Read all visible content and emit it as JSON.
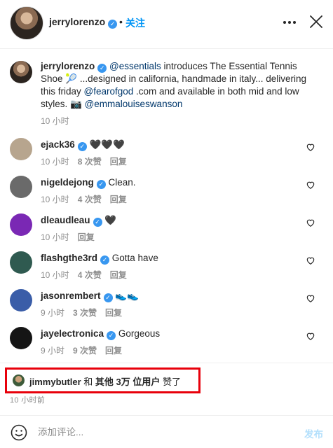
{
  "header": {
    "username": "jerrylorenzo",
    "separator": "•",
    "follow_label": "关注",
    "more_icon": "more-horizontal-icon",
    "close_icon": "close-icon"
  },
  "caption": {
    "username": "jerrylorenzo",
    "mention_1": "@essentials",
    "text_1": " introduces The Essential Tennis Shoe 🎾 ...designed in california, handmade in italy... delivering this friday ",
    "mention_2": "@fearofgod",
    "text_2": " .com and available in both mid and low styles. 📷 ",
    "mention_3": "@emmalouiseswanson",
    "time": "10 小时"
  },
  "comments": [
    {
      "username": "ejack36",
      "text": "🖤🖤🖤",
      "time": "10 小时",
      "likes": "8 次赞",
      "reply": "回复",
      "avatar_color": "#b7a58e"
    },
    {
      "username": "nigeldejong",
      "text": "Clean.",
      "time": "10 小时",
      "likes": "4 次赞",
      "reply": "回复",
      "avatar_color": "#6a6a6a"
    },
    {
      "username": "dleaudleau",
      "text": "🖤",
      "time": "10 小时",
      "likes": "",
      "reply": "回复",
      "avatar_color": "#7a28b4"
    },
    {
      "username": "flashgthe3rd",
      "text": "Gotta have",
      "time": "10 小时",
      "likes": "4 次赞",
      "reply": "回复",
      "avatar_color": "#2f5a50"
    },
    {
      "username": "jasonrembert",
      "text": "👟👟",
      "time": "9 小时",
      "likes": "3 次赞",
      "reply": "回复",
      "avatar_color": "#3a5da8"
    },
    {
      "username": "jayelectronica",
      "text": "Gorgeous",
      "time": "9 小时",
      "likes": "9 次赞",
      "reply": "回复",
      "avatar_color": "#151515"
    }
  ],
  "likes": {
    "username": "jimmybutler",
    "and": " 和 ",
    "others": "其他 3万 位用户",
    "liked": " 赞了"
  },
  "post_time": "10 小时前",
  "composer": {
    "placeholder": "添加评论...",
    "post_label": "发布",
    "emoji_icon": "emoji-icon"
  },
  "colors": {
    "accent": "#0095f6",
    "verified": "#3897f0",
    "link": "#00376b",
    "highlight_border": "#e8000b",
    "post_disabled": "#b2dffc"
  }
}
